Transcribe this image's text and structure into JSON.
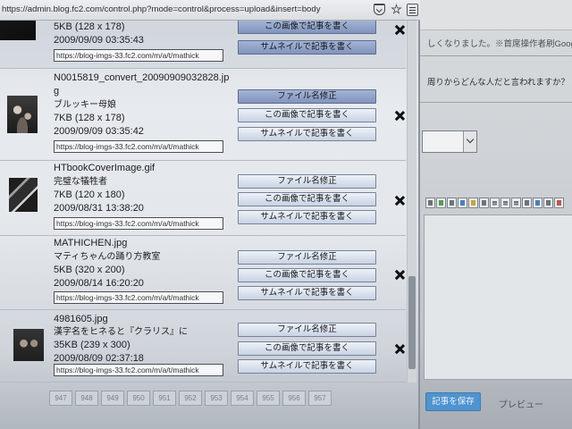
{
  "browser": {
    "url": "https://admin.blog.fc2.com/control.php?mode=control&process=upload&insert=body",
    "icons": [
      "pocket-icon",
      "star-icon",
      "menu-icon"
    ]
  },
  "image_list": {
    "buttons": {
      "rename": "ファイル名修正",
      "write": "この画像で記事を書く",
      "write_thumb": "サムネイルで記事を書く"
    },
    "items": [
      {
        "size": "5KB (128 x 178)",
        "date": "2009/09/09 03:35:43",
        "url": "https://blog-imgs-33.fc2.com/m/a/t/mathick"
      },
      {
        "filename": "N0015819_convert_20090909032828.jpg",
        "title": "ブルッキー母娘",
        "size": "7KB (128 x 178)",
        "date": "2009/09/09 03:35:42",
        "url": "https://blog-imgs-33.fc2.com/m/a/t/mathick"
      },
      {
        "filename": "HTbookCoverImage.gif",
        "title": "完璧な犠牲者",
        "size": "7KB (120 x 180)",
        "date": "2009/08/31 13:38:20",
        "url": "https://blog-imgs-33.fc2.com/m/a/t/mathick"
      },
      {
        "filename": "MATHICHEN.jpg",
        "title": "マティちゃんの踊り方教室",
        "size": "5KB (320 x 200)",
        "date": "2009/08/14 16:20:20",
        "url": "https://blog-imgs-33.fc2.com/m/a/t/mathick"
      },
      {
        "filename": "4981605.jpg",
        "title": "漢字名をヒネると『クラリス』に",
        "size": "35KB (239 x 300)",
        "date": "2009/08/09 02:37:18",
        "url": "https://blog-imgs-33.fc2.com/m/a/t/mathick"
      }
    ],
    "scroll_fraction": 0.95
  },
  "pagination": {
    "pages": [
      "947",
      "948",
      "949",
      "950",
      "951",
      "952",
      "953",
      "954",
      "955",
      "956",
      "957"
    ]
  },
  "editor": {
    "notice": "しくなりました。※首席操作者刷Google",
    "question": "周りからどんな人だと言われますか？",
    "save_button": "記事を保存",
    "preview_link": "プレビュー",
    "toolbar_icons": [
      "more-icon",
      "image-icon",
      "file-icon",
      "video-icon",
      "emoji-icon",
      "table-icon",
      "align-left-icon",
      "align-center-icon",
      "align-right-icon",
      "edit-icon",
      "link-icon",
      "quote-icon",
      "color-icon"
    ]
  },
  "colors": {
    "save_button": "#4f93cf",
    "highlight_button": "#8294bd"
  }
}
